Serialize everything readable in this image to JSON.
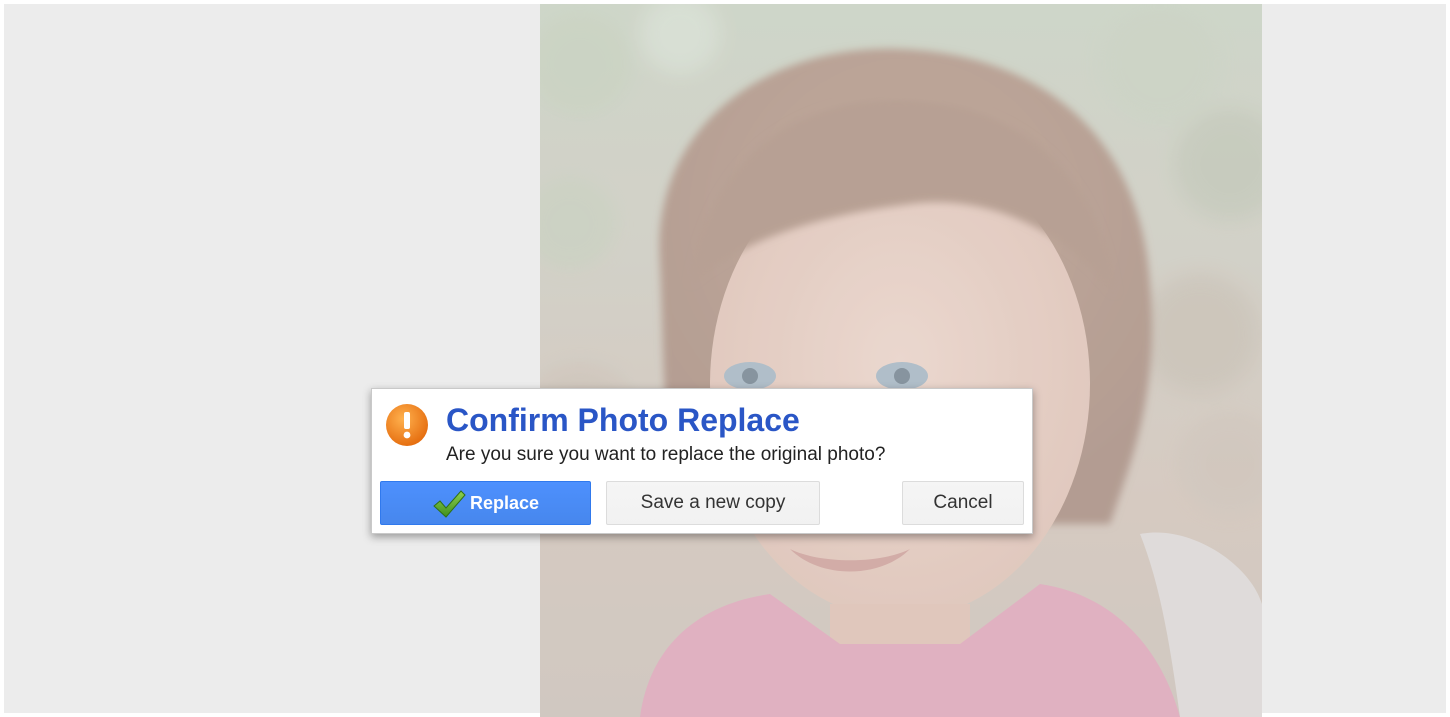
{
  "dialog": {
    "title": "Confirm Photo Replace",
    "message": "Are you sure you want to replace the original photo?",
    "icon": "warning-icon",
    "buttons": {
      "replace_label": "Replace",
      "save_copy_label": "Save a new copy",
      "cancel_label": "Cancel"
    }
  },
  "colors": {
    "title": "#2a56c6",
    "primary_button": "#4d90fe",
    "warning_icon": "#f08a24",
    "backdrop": "#ececec"
  }
}
